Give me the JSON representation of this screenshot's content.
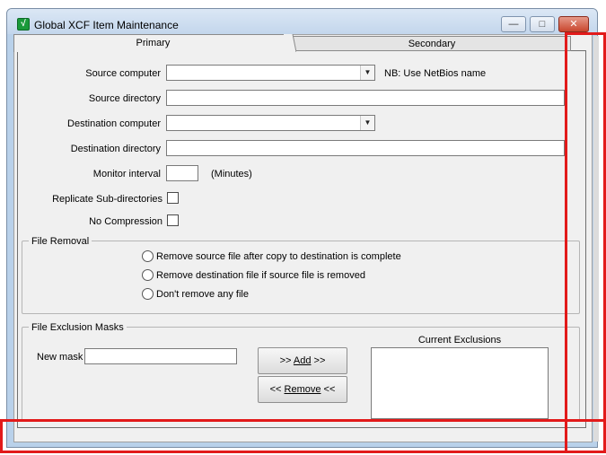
{
  "window": {
    "title": "Global XCF Item Maintenance",
    "app_icon_glyph": "√",
    "controls": {
      "minimize": "—",
      "maximize": "□",
      "close": "✕"
    }
  },
  "tabs": {
    "primary": "Primary",
    "secondary": "Secondary"
  },
  "form": {
    "source_computer": {
      "label": "Source computer",
      "value": "",
      "note": "NB: Use NetBios name"
    },
    "source_directory": {
      "label": "Source directory",
      "value": ""
    },
    "destination_computer": {
      "label": "Destination computer",
      "value": ""
    },
    "destination_directory": {
      "label": "Destination directory",
      "value": ""
    },
    "monitor_interval": {
      "label": "Monitor interval",
      "value": "",
      "unit": "(Minutes)"
    },
    "replicate_subdirs": {
      "label": "Replicate Sub-directories",
      "checked": false
    },
    "no_compression": {
      "label": "No Compression",
      "checked": false
    }
  },
  "file_removal": {
    "title": "File Removal",
    "options": [
      "Remove source file after copy to destination is complete",
      "Remove destination file if source file is removed",
      "Don't remove any file"
    ]
  },
  "exclusion": {
    "title": "File Exclusion Masks",
    "new_mask_label": "New mask",
    "new_mask_value": "",
    "add_prefix": ">>",
    "add_label": "Add",
    "add_suffix": ">>",
    "remove_prefix": "<<",
    "remove_label": "Remove",
    "remove_suffix": "<<",
    "current_label": "Current Exclusions",
    "current_items": []
  },
  "colors": {
    "highlight": "#e21a1a",
    "title_bar": "#c3d6ec",
    "close_button": "#c9452d"
  }
}
